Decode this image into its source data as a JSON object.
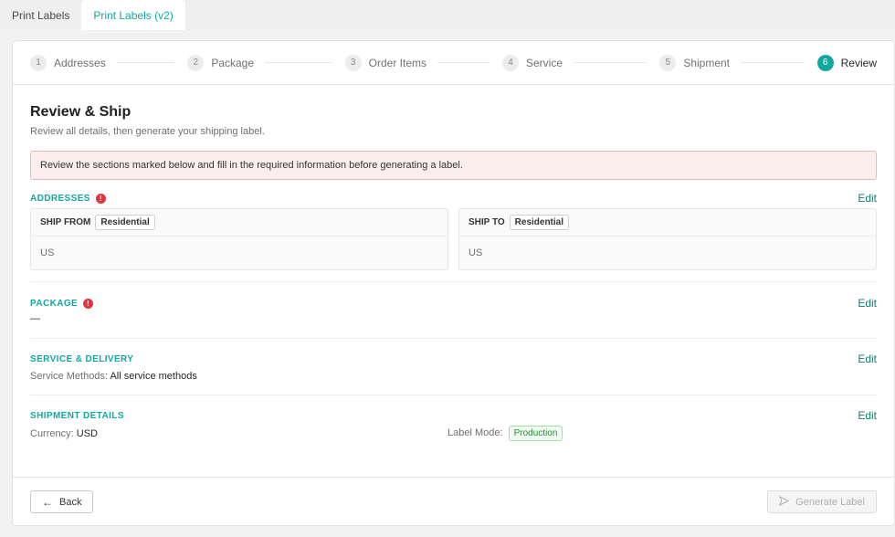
{
  "tabs": [
    {
      "label": "Print Labels"
    },
    {
      "label": "Print Labels (v2)"
    }
  ],
  "steps": [
    {
      "num": "1",
      "label": "Addresses"
    },
    {
      "num": "2",
      "label": "Package"
    },
    {
      "num": "3",
      "label": "Order Items"
    },
    {
      "num": "4",
      "label": "Service"
    },
    {
      "num": "5",
      "label": "Shipment"
    },
    {
      "num": "6",
      "label": "Review"
    }
  ],
  "page": {
    "title": "Review & Ship",
    "subtitle": "Review all details, then generate your shipping label."
  },
  "alert": "Review the sections marked below and fill in the required information before generating a label.",
  "sections": {
    "addresses": {
      "title": "ADDRESSES",
      "edit": "Edit",
      "ship_from": {
        "label": "SHIP FROM",
        "tag": "Residential",
        "value": "US"
      },
      "ship_to": {
        "label": "SHIP TO",
        "tag": "Residential",
        "value": "US"
      }
    },
    "package": {
      "title": "PACKAGE",
      "edit": "Edit",
      "value": "—"
    },
    "service": {
      "title": "SERVICE & DELIVERY",
      "edit": "Edit",
      "methods_label": "Service Methods",
      "methods_value": "All service methods"
    },
    "shipment": {
      "title": "SHIPMENT DETAILS",
      "edit": "Edit",
      "currency_label": "Currency",
      "currency_value": "USD",
      "label_mode_label": "Label Mode",
      "label_mode_value": "Production"
    }
  },
  "footer": {
    "back": "Back",
    "generate": "Generate Label"
  },
  "icons": {
    "warning": "exclamation-circle-icon",
    "back": "arrow-left-icon",
    "generate": "send-icon"
  },
  "colors": {
    "accent": "#13a89e",
    "error": "#e5343d",
    "alert_bg": "#fdeeee"
  }
}
